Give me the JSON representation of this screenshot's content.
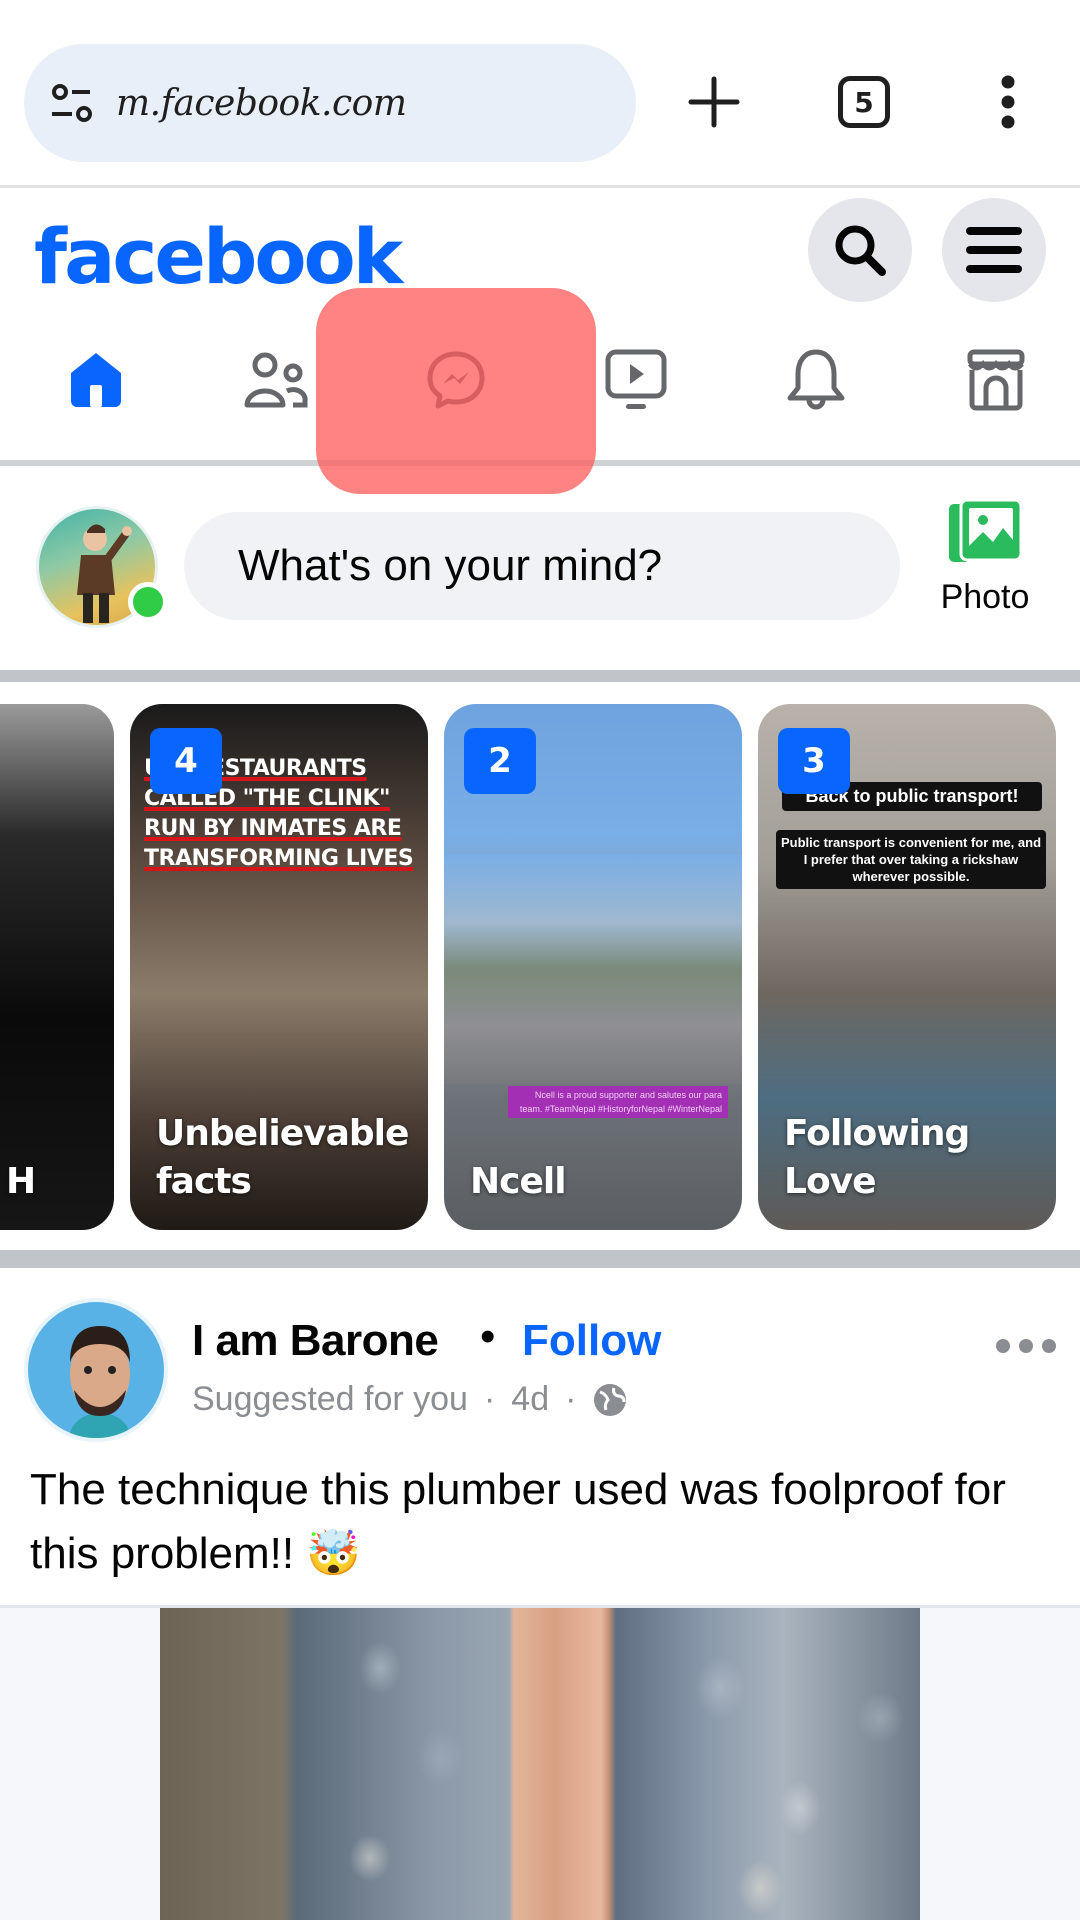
{
  "browser": {
    "url": "m.facebook.com",
    "tab_count": "5",
    "icons": {
      "site_settings": "tune-icon",
      "new_tab": "plus-icon",
      "tabs": "tab-switcher-icon",
      "menu": "more-vert-icon"
    }
  },
  "header": {
    "logo": "facebook",
    "brand_color": "#0866ff",
    "search_icon": "search-icon",
    "menu_icon": "hamburger-icon"
  },
  "nav": {
    "items": [
      {
        "name": "home",
        "icon": "home-icon",
        "active": true
      },
      {
        "name": "friends",
        "icon": "friends-icon",
        "active": false
      },
      {
        "name": "messenger",
        "icon": "messenger-icon",
        "active": false,
        "highlighted": true
      },
      {
        "name": "video",
        "icon": "video-icon",
        "active": false
      },
      {
        "name": "notifications",
        "icon": "bell-icon",
        "active": false
      },
      {
        "name": "marketplace",
        "icon": "marketplace-icon",
        "active": false
      }
    ],
    "highlight_color": "#ff5a5a"
  },
  "composer": {
    "placeholder": "What's on your mind?",
    "photo_label": "Photo",
    "online_status_color": "#31cc46"
  },
  "stories": [
    {
      "name": "H",
      "count": null,
      "overlay_text": ""
    },
    {
      "name": "Unbelievable facts",
      "count": "4",
      "overlay_text": "U     N RESTAURANTS CALLED \"THE CLINK\" RUN BY INMATES ARE TRANSFORMING LIVES"
    },
    {
      "name": "Ncell",
      "count": "2",
      "overlay_text": "Ncell is a proud supporter and salutes our para team. #TeamNepal #HistoryforNepal #WinterNepal"
    },
    {
      "name": "Following Love",
      "count": "3",
      "overlay_title": "Back to public transport!",
      "overlay_text": "Public transport is convenient for me, and I prefer that over taking a rickshaw wherever possible."
    }
  ],
  "post": {
    "author": "I am Barone",
    "separator": "•",
    "follow_label": "Follow",
    "suggestion": "Suggested for you",
    "age": "4d",
    "meta_dot": "·",
    "audience_icon": "globe-icon",
    "more_icon": "more-horiz-icon",
    "text": "The technique this plumber used was foolproof for this problem!! 🤯"
  }
}
